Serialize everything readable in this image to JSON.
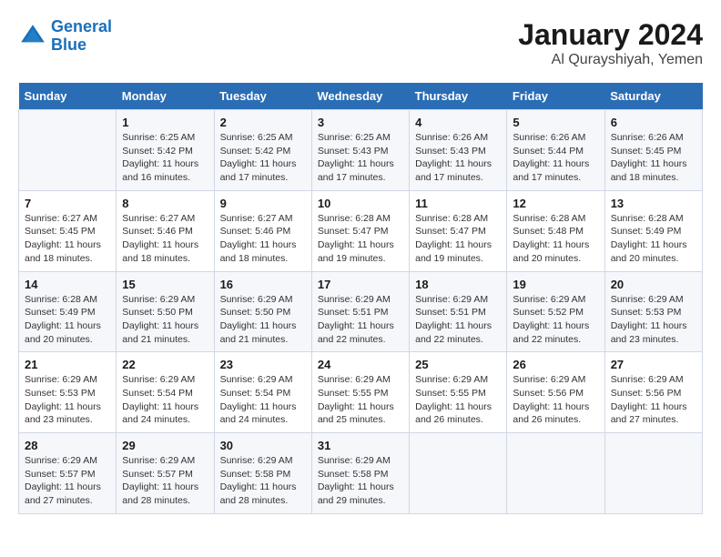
{
  "logo": {
    "line1": "General",
    "line2": "Blue"
  },
  "title": "January 2024",
  "subtitle": "Al Qurayshiyah, Yemen",
  "days_of_week": [
    "Sunday",
    "Monday",
    "Tuesday",
    "Wednesday",
    "Thursday",
    "Friday",
    "Saturday"
  ],
  "weeks": [
    [
      {
        "num": "",
        "info": ""
      },
      {
        "num": "1",
        "info": "Sunrise: 6:25 AM\nSunset: 5:42 PM\nDaylight: 11 hours\nand 16 minutes."
      },
      {
        "num": "2",
        "info": "Sunrise: 6:25 AM\nSunset: 5:42 PM\nDaylight: 11 hours\nand 17 minutes."
      },
      {
        "num": "3",
        "info": "Sunrise: 6:25 AM\nSunset: 5:43 PM\nDaylight: 11 hours\nand 17 minutes."
      },
      {
        "num": "4",
        "info": "Sunrise: 6:26 AM\nSunset: 5:43 PM\nDaylight: 11 hours\nand 17 minutes."
      },
      {
        "num": "5",
        "info": "Sunrise: 6:26 AM\nSunset: 5:44 PM\nDaylight: 11 hours\nand 17 minutes."
      },
      {
        "num": "6",
        "info": "Sunrise: 6:26 AM\nSunset: 5:45 PM\nDaylight: 11 hours\nand 18 minutes."
      }
    ],
    [
      {
        "num": "7",
        "info": "Sunrise: 6:27 AM\nSunset: 5:45 PM\nDaylight: 11 hours\nand 18 minutes."
      },
      {
        "num": "8",
        "info": "Sunrise: 6:27 AM\nSunset: 5:46 PM\nDaylight: 11 hours\nand 18 minutes."
      },
      {
        "num": "9",
        "info": "Sunrise: 6:27 AM\nSunset: 5:46 PM\nDaylight: 11 hours\nand 18 minutes."
      },
      {
        "num": "10",
        "info": "Sunrise: 6:28 AM\nSunset: 5:47 PM\nDaylight: 11 hours\nand 19 minutes."
      },
      {
        "num": "11",
        "info": "Sunrise: 6:28 AM\nSunset: 5:47 PM\nDaylight: 11 hours\nand 19 minutes."
      },
      {
        "num": "12",
        "info": "Sunrise: 6:28 AM\nSunset: 5:48 PM\nDaylight: 11 hours\nand 20 minutes."
      },
      {
        "num": "13",
        "info": "Sunrise: 6:28 AM\nSunset: 5:49 PM\nDaylight: 11 hours\nand 20 minutes."
      }
    ],
    [
      {
        "num": "14",
        "info": "Sunrise: 6:28 AM\nSunset: 5:49 PM\nDaylight: 11 hours\nand 20 minutes."
      },
      {
        "num": "15",
        "info": "Sunrise: 6:29 AM\nSunset: 5:50 PM\nDaylight: 11 hours\nand 21 minutes."
      },
      {
        "num": "16",
        "info": "Sunrise: 6:29 AM\nSunset: 5:50 PM\nDaylight: 11 hours\nand 21 minutes."
      },
      {
        "num": "17",
        "info": "Sunrise: 6:29 AM\nSunset: 5:51 PM\nDaylight: 11 hours\nand 22 minutes."
      },
      {
        "num": "18",
        "info": "Sunrise: 6:29 AM\nSunset: 5:51 PM\nDaylight: 11 hours\nand 22 minutes."
      },
      {
        "num": "19",
        "info": "Sunrise: 6:29 AM\nSunset: 5:52 PM\nDaylight: 11 hours\nand 22 minutes."
      },
      {
        "num": "20",
        "info": "Sunrise: 6:29 AM\nSunset: 5:53 PM\nDaylight: 11 hours\nand 23 minutes."
      }
    ],
    [
      {
        "num": "21",
        "info": "Sunrise: 6:29 AM\nSunset: 5:53 PM\nDaylight: 11 hours\nand 23 minutes."
      },
      {
        "num": "22",
        "info": "Sunrise: 6:29 AM\nSunset: 5:54 PM\nDaylight: 11 hours\nand 24 minutes."
      },
      {
        "num": "23",
        "info": "Sunrise: 6:29 AM\nSunset: 5:54 PM\nDaylight: 11 hours\nand 24 minutes."
      },
      {
        "num": "24",
        "info": "Sunrise: 6:29 AM\nSunset: 5:55 PM\nDaylight: 11 hours\nand 25 minutes."
      },
      {
        "num": "25",
        "info": "Sunrise: 6:29 AM\nSunset: 5:55 PM\nDaylight: 11 hours\nand 26 minutes."
      },
      {
        "num": "26",
        "info": "Sunrise: 6:29 AM\nSunset: 5:56 PM\nDaylight: 11 hours\nand 26 minutes."
      },
      {
        "num": "27",
        "info": "Sunrise: 6:29 AM\nSunset: 5:56 PM\nDaylight: 11 hours\nand 27 minutes."
      }
    ],
    [
      {
        "num": "28",
        "info": "Sunrise: 6:29 AM\nSunset: 5:57 PM\nDaylight: 11 hours\nand 27 minutes."
      },
      {
        "num": "29",
        "info": "Sunrise: 6:29 AM\nSunset: 5:57 PM\nDaylight: 11 hours\nand 28 minutes."
      },
      {
        "num": "30",
        "info": "Sunrise: 6:29 AM\nSunset: 5:58 PM\nDaylight: 11 hours\nand 28 minutes."
      },
      {
        "num": "31",
        "info": "Sunrise: 6:29 AM\nSunset: 5:58 PM\nDaylight: 11 hours\nand 29 minutes."
      },
      {
        "num": "",
        "info": ""
      },
      {
        "num": "",
        "info": ""
      },
      {
        "num": "",
        "info": ""
      }
    ]
  ]
}
